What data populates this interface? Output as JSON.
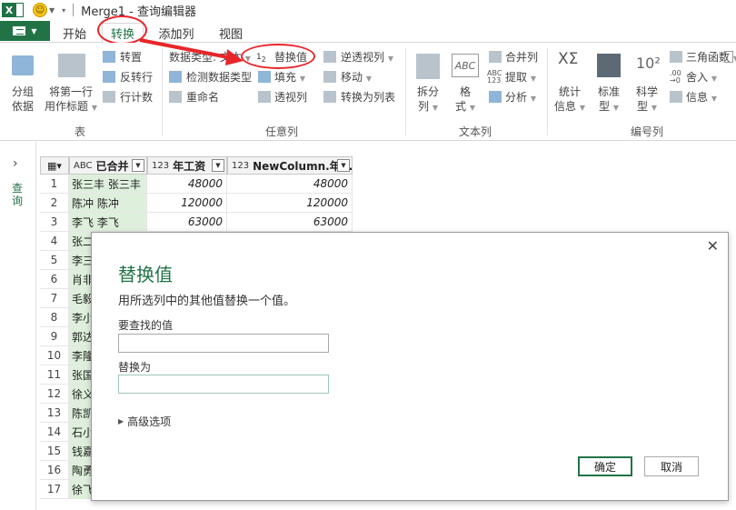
{
  "window": {
    "title": "Merge1 - 查询编辑器"
  },
  "tabs": {
    "file": "",
    "home": "开始",
    "transform": "转换",
    "add_column": "添加列",
    "view": "视图"
  },
  "ribbon": {
    "table_group": {
      "label": "表",
      "group_by": [
        "分组",
        "依据"
      ],
      "use_first_row": [
        "将第一行",
        "用作标题"
      ],
      "transpose": "转置",
      "reverse_rows": "反转行",
      "count_rows": "行计数"
    },
    "any_column_group": {
      "label": "任意列",
      "data_type": "数据类型: 文本",
      "detect_type": "检测数据类型",
      "rename": "重命名",
      "replace_values": "替换值",
      "fill": "填充",
      "pivot": "透视列",
      "unpivot": "逆透视列",
      "move": "移动",
      "to_list": "转换为列表"
    },
    "text_column_group": {
      "label": "文本列",
      "split": [
        "拆分",
        "列"
      ],
      "format": [
        "格",
        "式"
      ],
      "merge": "合并列",
      "extract": "提取",
      "parse": "分析"
    },
    "number_column_group": {
      "label": "编号列",
      "statistics": [
        "统计",
        "信息"
      ],
      "standard": [
        "标准",
        "型"
      ],
      "scientific": [
        "科学",
        "型"
      ],
      "trig": "三角函数",
      "rounding": "舍入",
      "info": "信息"
    }
  },
  "left_pane": {
    "label": "查询"
  },
  "grid": {
    "columns": [
      {
        "type": "ABC",
        "name": "已合并"
      },
      {
        "type": "123",
        "name": "年工资"
      },
      {
        "type": "123",
        "name": "NewColumn.年..."
      }
    ],
    "rows": [
      {
        "n": "1",
        "name": "张三丰 张三丰",
        "v1": "48000",
        "v2": "48000"
      },
      {
        "n": "2",
        "name": "陈冲 陈冲",
        "v1": "120000",
        "v2": "120000"
      },
      {
        "n": "3",
        "name": "李飞 李飞",
        "v1": "63000",
        "v2": "63000"
      },
      {
        "n": "4",
        "name": "张二",
        "v1": "",
        "v2": ""
      },
      {
        "n": "5",
        "name": "李三",
        "v1": "",
        "v2": ""
      },
      {
        "n": "6",
        "name": "肖非",
        "v1": "",
        "v2": ""
      },
      {
        "n": "7",
        "name": "毛毅",
        "v1": "",
        "v2": ""
      },
      {
        "n": "8",
        "name": "李小",
        "v1": "",
        "v2": ""
      },
      {
        "n": "9",
        "name": "郭达",
        "v1": "",
        "v2": ""
      },
      {
        "n": "10",
        "name": "李隆",
        "v1": "",
        "v2": ""
      },
      {
        "n": "11",
        "name": "张国",
        "v1": "",
        "v2": ""
      },
      {
        "n": "12",
        "name": "徐义",
        "v1": "",
        "v2": ""
      },
      {
        "n": "13",
        "name": "陈凯",
        "v1": "",
        "v2": ""
      },
      {
        "n": "14",
        "name": "石小",
        "v1": "",
        "v2": ""
      },
      {
        "n": "15",
        "name": "钱嘉",
        "v1": "",
        "v2": ""
      },
      {
        "n": "16",
        "name": "陶勇",
        "v1": "",
        "v2": ""
      },
      {
        "n": "17",
        "name": "徐飞",
        "v1": "",
        "v2": ""
      }
    ]
  },
  "dialog": {
    "title": "替换值",
    "description": "用所选列中的其他值替换一个值。",
    "find_label": "要查找的值",
    "find_value": "",
    "replace_label": "替换为",
    "replace_value": "",
    "advanced": "高级选项",
    "ok": "确定",
    "cancel": "取消"
  },
  "colors": {
    "accent": "#217346",
    "annotation": "#e8262a",
    "selected_column": "#def0dc"
  }
}
